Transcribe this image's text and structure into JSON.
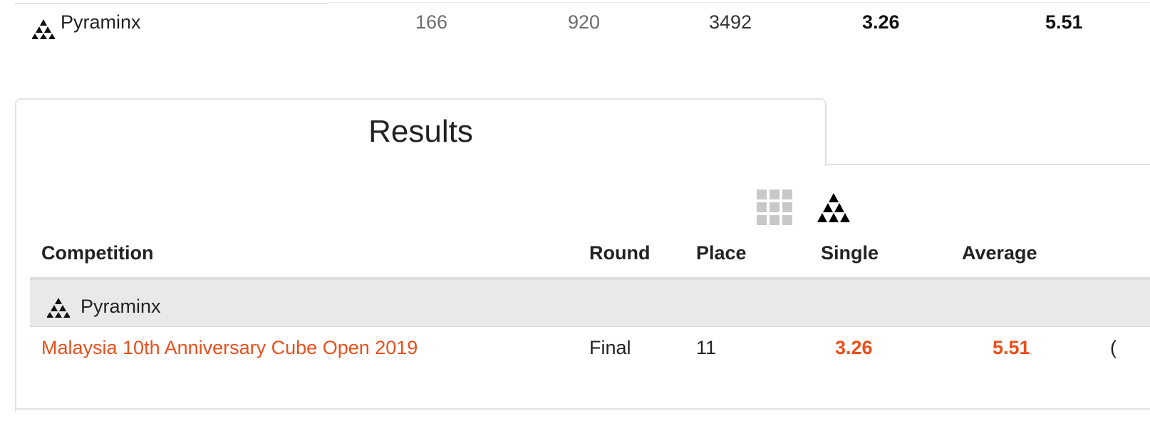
{
  "record_row": {
    "event": "Pyraminx",
    "icon": "pyraminx-icon",
    "nr": "166",
    "cr": "920",
    "wr": "3492",
    "single": "3.26",
    "average": "5.51"
  },
  "tabs": {
    "active_label": "Results"
  },
  "event_selector": {
    "icons": [
      "all-events-grid-icon",
      "pyraminx-icon"
    ]
  },
  "table": {
    "headers": {
      "competition": "Competition",
      "round": "Round",
      "place": "Place",
      "single": "Single",
      "average": "Average"
    },
    "group": {
      "event": "Pyraminx",
      "icon": "pyraminx-icon"
    },
    "rows": [
      {
        "competition": "Malaysia 10th Anniversary Cube Open 2019",
        "round": "Final",
        "place": "11",
        "single": "3.26",
        "average": "5.51",
        "solves_truncated": "("
      }
    ]
  },
  "colors": {
    "accent": "#e8501c",
    "group_bg": "#e9e9e9",
    "border": "#e3e3e3",
    "muted_icon": "#c8c8c8"
  }
}
